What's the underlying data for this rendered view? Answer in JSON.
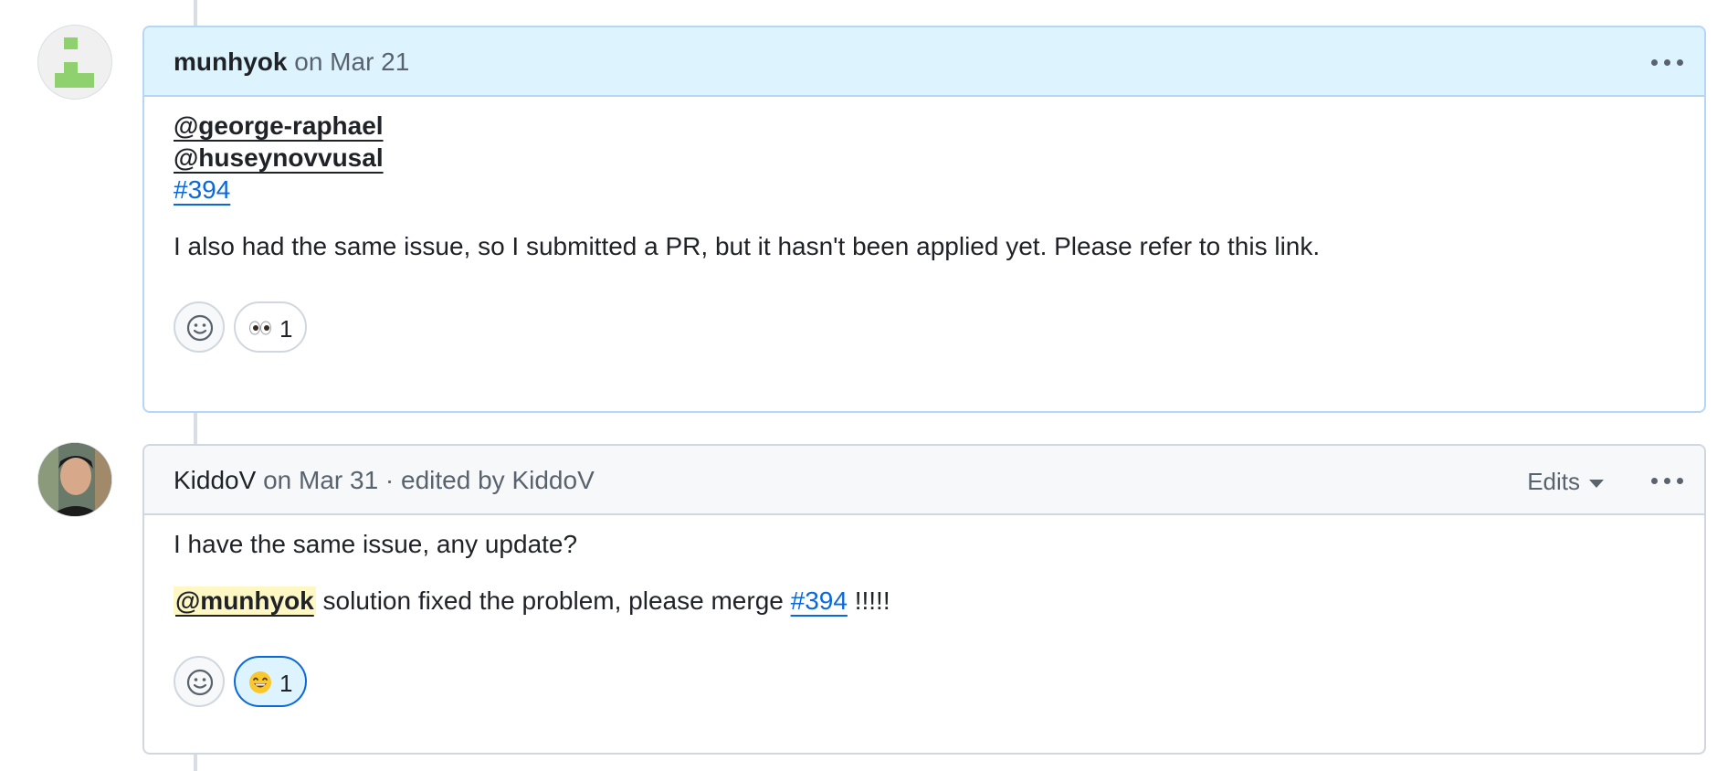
{
  "comments": [
    {
      "author": "munhyok",
      "meta": "on Mar 21",
      "mentions": [
        "@george-raphael",
        "@huseynovvusal"
      ],
      "issue_link": "#394",
      "text": "I also had the same issue, so I submitted a PR, but it hasn't been applied yet. Please refer to this link.",
      "reaction": {
        "emoji": "eyes",
        "count": "1"
      }
    },
    {
      "author": "KiddoV",
      "meta": "on Mar 31 · edited by KiddoV",
      "edits_label": "Edits",
      "text1": "I have the same issue, any update?",
      "mention": "@munhyok",
      "text2_mid": " solution fixed the problem, please merge ",
      "issue_link": "#394",
      "text2_end": " !!!!!",
      "reaction": {
        "emoji": "grinning-face",
        "count": "1"
      }
    }
  ],
  "colors": {
    "highlight_header": "#ddf4ff",
    "link": "#0969da",
    "mention_highlight": "#fff8c5"
  }
}
